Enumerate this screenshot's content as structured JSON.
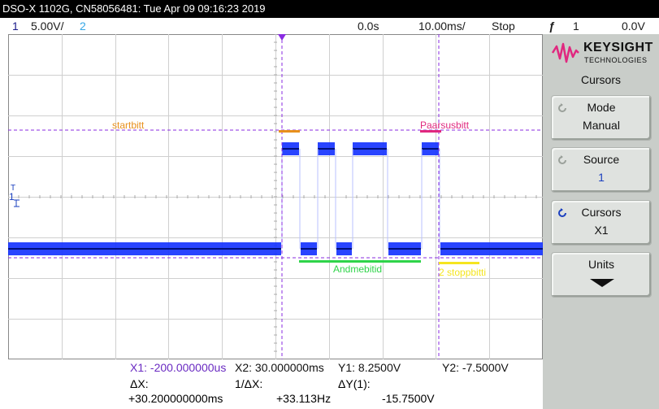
{
  "titlebar": {
    "text": "DSO-X 1102G, CN58056481: Tue Apr 09 09:16:23 2019"
  },
  "status": {
    "channel1_num": "1",
    "channel1_scale": "5.00V/",
    "channel2_num": "2",
    "time_delay": "0.0s",
    "time_scale": "10.00ms/",
    "run_state": "Stop",
    "trigger_icon": "trigger-edge-icon",
    "trigger_channel": "1",
    "trigger_level": "0.0V"
  },
  "waveform": {
    "annotations": {
      "startbit": "startbitt",
      "parity": "Paarsusbitt",
      "data": "Andmebitid",
      "stop": "2 stoppbitti"
    },
    "markers": {
      "trigger": "T",
      "ground": "1"
    },
    "colors": {
      "trace": "#1230ff",
      "cursor": "#8a2be2",
      "startbit": "#e8901c",
      "parity": "#e0287f",
      "data": "#2fd44a",
      "stop": "#f5e51f"
    }
  },
  "readout": {
    "x1": "X1: -200.000000us",
    "x2": "X2:  30.000000ms",
    "y1": "Y1:  8.2500V",
    "y2": "Y2: -7.5000V",
    "dx_label": "ΔX:",
    "dx_value": "+30.200000000ms",
    "inv_dx_label": "1/ΔX:",
    "inv_dx_value": "+33.113Hz",
    "dy_label": "ΔY(1):",
    "dy_value": "-15.7500V"
  },
  "panel": {
    "brand": "KEYSIGHT",
    "brand_sub": "TECHNOLOGIES",
    "title": "Cursors",
    "softkeys": [
      {
        "label": "Mode",
        "value": "Manual",
        "icon": "rotate-knob-icon"
      },
      {
        "label": "Source",
        "value": "1",
        "icon": "rotate-knob-icon"
      },
      {
        "label": "Cursors",
        "value": "X1",
        "icon": "rotate-knob-active-icon"
      },
      {
        "label": "Units",
        "value": "",
        "icon": "submenu-arrow-icon"
      }
    ]
  }
}
